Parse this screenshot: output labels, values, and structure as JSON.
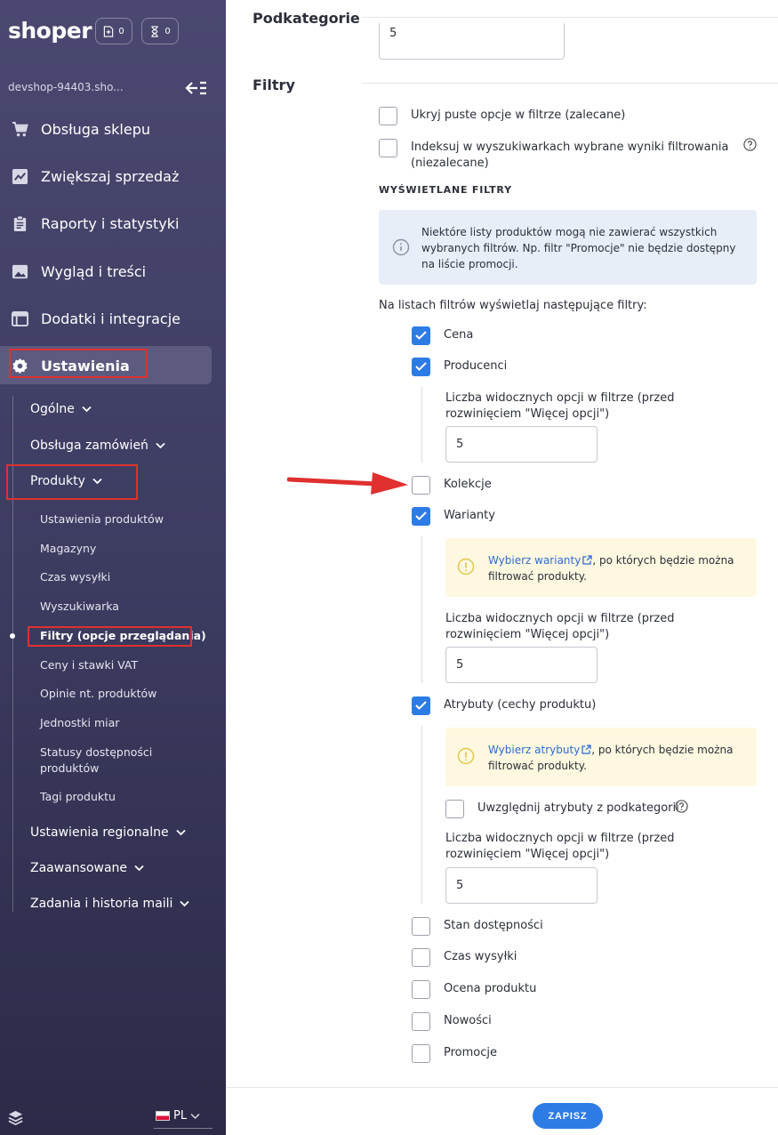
{
  "brand": "shoper",
  "header": {
    "badge1_count": "0",
    "badge2_count": "0"
  },
  "shop_name": "devshop-94403.sho...",
  "menu": [
    {
      "label": "Obsługa sklepu",
      "icon": "cart-icon"
    },
    {
      "label": "Zwiększaj sprzedaż",
      "icon": "chart-icon"
    },
    {
      "label": "Raporty i statystyki",
      "icon": "clipboard-icon"
    },
    {
      "label": "Wygląd i treści",
      "icon": "image-icon"
    },
    {
      "label": "Dodatki i integracje",
      "icon": "window-icon"
    },
    {
      "label": "Ustawienia",
      "icon": "gear-icon"
    }
  ],
  "settings_sub": [
    "Ogólne",
    "Obsługa zamówień",
    "Produkty",
    "Ustawienia regionalne",
    "Zaawansowane",
    "Zadania i historia maili"
  ],
  "products_sub": [
    "Ustawienia produktów",
    "Magazyny",
    "Czas wysyłki",
    "Wyszukiwarka",
    "Filtry (opcje przeglądania)",
    "Ceny i stawki VAT",
    "Opinie nt. produktów",
    "Jednostki miar",
    "Statusy dostępności produktów",
    "Tagi produktu"
  ],
  "language": "PL",
  "main": {
    "section_subcategories": "Podkategorie",
    "subcategories_value": "5",
    "section_filters": "Filtry",
    "hide_empty": "Ukryj puste opcje w filtrze (zalecane)",
    "index_search": "Indeksuj w wyszukiwarkach wybrane wyniki filtrowania (niezalecane)",
    "displayed_filters_heading": "WYŚWIETLANE FILTRY",
    "info_text": "Niektóre listy produktów mogą nie zawierać wszystkich wybranych filtrów. Np. filtr \"Promocje\" nie będzie dostępny na liście promocji.",
    "list_intro": "Na listach filtrów wyświetlaj następujące filtry:",
    "filters": [
      {
        "label": "Cena",
        "checked": true
      },
      {
        "label": "Producenci",
        "checked": true
      },
      {
        "label": "Kolekcje",
        "checked": false
      },
      {
        "label": "Warianty",
        "checked": true
      },
      {
        "label": "Atrybuty (cechy produktu)",
        "checked": true
      },
      {
        "label": "Stan dostępności",
        "checked": false
      },
      {
        "label": "Czas wysyłki",
        "checked": false
      },
      {
        "label": "Ocena produktu",
        "checked": false
      },
      {
        "label": "Nowości",
        "checked": false
      },
      {
        "label": "Promocje",
        "checked": false
      }
    ],
    "visible_options_label": "Liczba widocznych opcji w filtrze (przed rozwinięciem \"Więcej opcji\")",
    "producers_visible": "5",
    "variants_visible": "5",
    "attributes_visible": "5",
    "variants_warn_link": "Wybierz warianty",
    "variants_warn_rest": ", po których będzie można filtrować produkty.",
    "attributes_warn_link": "Wybierz atrybuty",
    "attributes_warn_rest": ", po których będzie można filtrować produkty.",
    "include_subcat_attrs": "Uwzględnij atrybuty z podkategorii",
    "save_label": "ZAPISZ"
  },
  "colors": {
    "sidebar": "#3b3a5f",
    "accent": "#2d7ce6",
    "highlight": "#e0302f"
  }
}
